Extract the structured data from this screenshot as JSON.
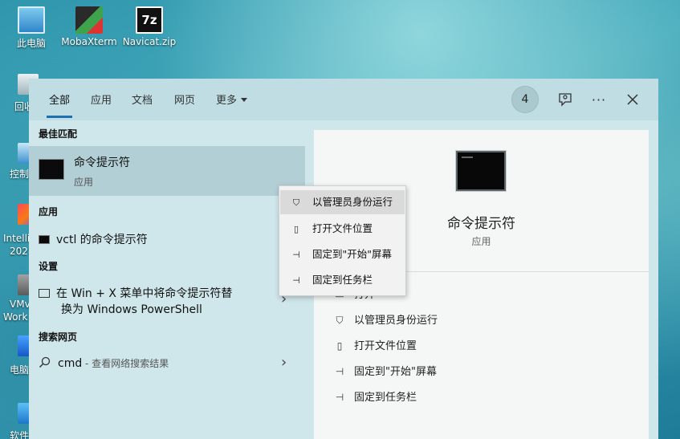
{
  "desktop": {
    "icons": [
      {
        "label": "此电脑"
      },
      {
        "label": "MobaXterm"
      },
      {
        "label": "Navicat.zip"
      }
    ],
    "edge_labels": [
      "回收",
      "控制",
      "Intelli",
      "202",
      "VMv",
      "Work",
      "电脑",
      "软件"
    ]
  },
  "tabs": [
    {
      "label": "全部"
    },
    {
      "label": "应用"
    },
    {
      "label": "文档"
    },
    {
      "label": "网页"
    },
    {
      "label": "更多"
    }
  ],
  "toolbar": {
    "badge_count": "4"
  },
  "sections": {
    "best_match": "最佳匹配",
    "apps": "应用",
    "settings": "设置",
    "web": "搜索网页"
  },
  "best_match": {
    "title": "命令提示符",
    "subtitle": "应用"
  },
  "apps_item": {
    "label": "vctl 的命令提示符"
  },
  "settings_item": {
    "line1": "在 Win + X 菜单中将命令提示符替",
    "line2": "换为 Windows PowerShell"
  },
  "web_item": {
    "query": "cmd",
    "suffix": " - 查看网络搜索结果"
  },
  "preview": {
    "title": "命令提示符",
    "subtitle": "应用",
    "actions": [
      {
        "label": "打开"
      },
      {
        "label": "以管理员身份运行"
      },
      {
        "label": "打开文件位置"
      },
      {
        "label": "固定到\"开始\"屏幕"
      },
      {
        "label": "固定到任务栏"
      }
    ]
  },
  "context_menu": {
    "items": [
      {
        "label": "以管理员身份运行"
      },
      {
        "label": "打开文件位置"
      },
      {
        "label": "固定到\"开始\"屏幕"
      },
      {
        "label": "固定到任务栏"
      }
    ]
  },
  "colors": {
    "accent": "#1c6fb3",
    "panel": "#cfe6ea",
    "preview": "#f5f6f6"
  }
}
